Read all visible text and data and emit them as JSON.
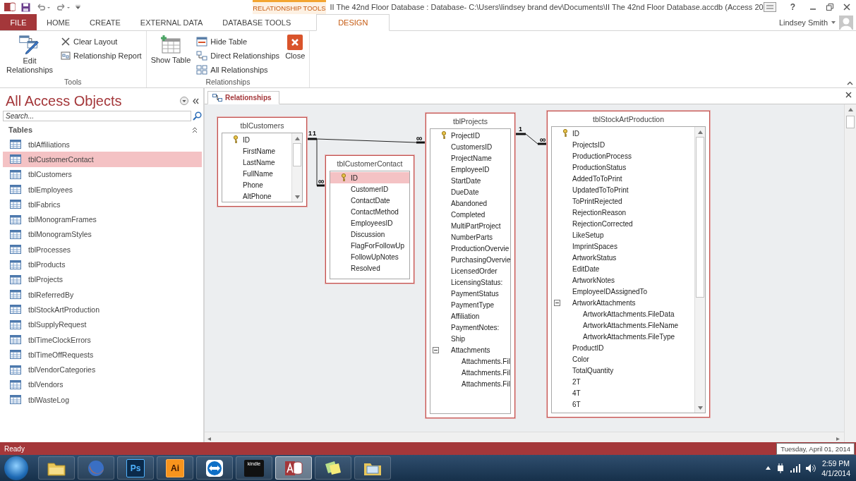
{
  "title_bar": {
    "context_tab": "RELATIONSHIP TOOLS",
    "title": "II The 42nd Floor Database : Database- C:\\Users\\lindsey brand dev\\Documents\\II The 42nd Floor Database.accdb (Access 20",
    "help": "?"
  },
  "ribbon_tabs": [
    {
      "label": "FILE",
      "kind": "file",
      "selected": false
    },
    {
      "label": "HOME",
      "kind": "tab",
      "selected": false
    },
    {
      "label": "CREATE",
      "kind": "tab",
      "selected": false
    },
    {
      "label": "EXTERNAL DATA",
      "kind": "tab",
      "selected": false
    },
    {
      "label": "DATABASE TOOLS",
      "kind": "tab",
      "selected": false
    },
    {
      "label": "DESIGN",
      "kind": "context",
      "selected": true
    }
  ],
  "user": {
    "name": "Lindsey Smith"
  },
  "ribbon_groups": [
    {
      "label": "Tools",
      "commands": [
        {
          "label": "Edit Relationships",
          "kind": "edit"
        },
        {
          "label": "Clear Layout",
          "kind": "clear"
        },
        {
          "label": "Relationship Report",
          "kind": "report"
        }
      ]
    },
    {
      "label": "Relationships",
      "commands": [
        {
          "label": "Show Table",
          "kind": "show"
        },
        {
          "label": "Hide Table",
          "kind": "hide"
        },
        {
          "label": "Direct Relationships",
          "kind": "direct"
        },
        {
          "label": "All Relationships",
          "kind": "all"
        },
        {
          "label": "Close",
          "kind": "close"
        }
      ]
    }
  ],
  "navigation_pane": {
    "title": "All Access Objects",
    "search": {
      "placeholder": "Search..."
    },
    "section": {
      "label": "Tables",
      "expanded": true
    },
    "items": [
      {
        "label": "tblAffiliations",
        "selected": false
      },
      {
        "label": "tblCustomerContact",
        "selected": true
      },
      {
        "label": "tblCustomers",
        "selected": false
      },
      {
        "label": "tblEmployees",
        "selected": false
      },
      {
        "label": "tblFabrics",
        "selected": false
      },
      {
        "label": "tblMonogramFrames",
        "selected": false
      },
      {
        "label": "tblMonogramStyles",
        "selected": false
      },
      {
        "label": "tblProcesses",
        "selected": false
      },
      {
        "label": "tblProducts",
        "selected": false
      },
      {
        "label": "tblProjects",
        "selected": false
      },
      {
        "label": "tblReferredBy",
        "selected": false
      },
      {
        "label": "tblStockArtProduction",
        "selected": false
      },
      {
        "label": "tblSupplyRequest",
        "selected": false
      },
      {
        "label": "tblTimeClockErrors",
        "selected": false
      },
      {
        "label": "tblTimeOffRequests",
        "selected": false
      },
      {
        "label": "tblVendorCategories",
        "selected": false
      },
      {
        "label": "tblVendors",
        "selected": false
      },
      {
        "label": "tblWasteLog",
        "selected": false
      }
    ]
  },
  "document_tabs": [
    {
      "label": "Relationships",
      "selected": true
    }
  ],
  "relationship_tables": [
    {
      "name": "tblCustomers",
      "scrollbar": true,
      "fields": [
        {
          "name": "ID",
          "key": true,
          "selected": false
        },
        {
          "name": "FirstName",
          "key": false,
          "selected": false
        },
        {
          "name": "LastName",
          "key": false,
          "selected": false
        },
        {
          "name": "FullName",
          "key": false,
          "selected": false
        },
        {
          "name": "Phone",
          "key": false,
          "selected": false
        },
        {
          "name": "AltPhone",
          "key": false,
          "selected": false
        }
      ]
    },
    {
      "name": "tblCustomerContact",
      "scrollbar": false,
      "fields": [
        {
          "name": "ID",
          "key": true,
          "selected": true
        },
        {
          "name": "CustomerID",
          "key": false,
          "selected": false
        },
        {
          "name": "ContactDate",
          "key": false,
          "selected": false
        },
        {
          "name": "ContactMethod",
          "key": false,
          "selected": false
        },
        {
          "name": "EmployeesID",
          "key": false,
          "selected": false
        },
        {
          "name": "Discussion",
          "key": false,
          "selected": false
        },
        {
          "name": "FlagForFollowUp",
          "key": false,
          "selected": false
        },
        {
          "name": "FollowUpNotes",
          "key": false,
          "selected": false
        },
        {
          "name": "Resolved",
          "key": false,
          "selected": false
        }
      ]
    },
    {
      "name": "tblProjects",
      "scrollbar": false,
      "fields": [
        {
          "name": "ProjectID",
          "key": true,
          "selected": false
        },
        {
          "name": "CustomersID",
          "key": false,
          "selected": false
        },
        {
          "name": "ProjectName",
          "key": false,
          "selected": false
        },
        {
          "name": "EmployeeID",
          "key": false,
          "selected": false
        },
        {
          "name": "StartDate",
          "key": false,
          "selected": false
        },
        {
          "name": "DueDate",
          "key": false,
          "selected": false
        },
        {
          "name": "Abandoned",
          "key": false,
          "selected": false
        },
        {
          "name": "Completed",
          "key": false,
          "selected": false
        },
        {
          "name": "MultiPartProject",
          "key": false,
          "selected": false
        },
        {
          "name": "NumberParts",
          "key": false,
          "selected": false
        },
        {
          "name": "ProductionOvervie",
          "key": false,
          "selected": false
        },
        {
          "name": "PurchasingOvervie",
          "key": false,
          "selected": false
        },
        {
          "name": "LicensedOrder",
          "key": false,
          "selected": false
        },
        {
          "name": "LicensingStatus:",
          "key": false,
          "selected": false
        },
        {
          "name": "PaymentStatus",
          "key": false,
          "selected": false
        },
        {
          "name": "PaymentType",
          "key": false,
          "selected": false
        },
        {
          "name": "Affiliation",
          "key": false,
          "selected": false
        },
        {
          "name": "PaymentNotes:",
          "key": false,
          "selected": false
        },
        {
          "name": "Ship",
          "key": false,
          "selected": false
        },
        {
          "name": "Attachments",
          "key": false,
          "selected": false,
          "expanded": true,
          "children": [
            {
              "name": "Attachments.Fil",
              "key": false,
              "selected": false
            },
            {
              "name": "Attachments.Fil",
              "key": false,
              "selected": false
            },
            {
              "name": "Attachments.Fil",
              "key": false,
              "selected": false
            }
          ]
        }
      ]
    },
    {
      "name": "tblStockArtProduction",
      "scrollbar": true,
      "fields": [
        {
          "name": "ID",
          "key": true,
          "selected": false
        },
        {
          "name": "ProjectsID",
          "key": false,
          "selected": false
        },
        {
          "name": "ProductionProcess",
          "key": false,
          "selected": false
        },
        {
          "name": "ProductionStatus",
          "key": false,
          "selected": false
        },
        {
          "name": "AddedToToPrint",
          "key": false,
          "selected": false
        },
        {
          "name": "UpdatedToToPrint",
          "key": false,
          "selected": false
        },
        {
          "name": "ToPrintRejected",
          "key": false,
          "selected": false
        },
        {
          "name": "RejectionReason",
          "key": false,
          "selected": false
        },
        {
          "name": "RejectionCorrected",
          "key": false,
          "selected": false
        },
        {
          "name": "LikeSetup",
          "key": false,
          "selected": false
        },
        {
          "name": "ImprintSpaces",
          "key": false,
          "selected": false
        },
        {
          "name": "ArtworkStatus",
          "key": false,
          "selected": false
        },
        {
          "name": "EditDate",
          "key": false,
          "selected": false
        },
        {
          "name": "ArtworkNotes",
          "key": false,
          "selected": false
        },
        {
          "name": "EmployeeIDAssignedTo",
          "key": false,
          "selected": false
        },
        {
          "name": "ArtworkAttachments",
          "key": false,
          "selected": false,
          "expanded": true,
          "children": [
            {
              "name": "ArtworkAttachments.FileData",
              "key": false,
              "selected": false
            },
            {
              "name": "ArtworkAttachments.FileName",
              "key": false,
              "selected": false
            },
            {
              "name": "ArtworkAttachments.FileType",
              "key": false,
              "selected": false
            }
          ]
        },
        {
          "name": "ProductID",
          "key": false,
          "selected": false
        },
        {
          "name": "Color",
          "key": false,
          "selected": false
        },
        {
          "name": "TotalQuantity",
          "key": false,
          "selected": false
        },
        {
          "name": "2T",
          "key": false,
          "selected": false
        },
        {
          "name": "4T",
          "key": false,
          "selected": false
        },
        {
          "name": "6T",
          "key": false,
          "selected": false
        }
      ]
    }
  ],
  "relationships": [
    {
      "from_label": "1",
      "to_label": "∞"
    },
    {
      "from_label": "1",
      "to_label": "∞"
    },
    {
      "from_label": "1",
      "to_label": "∞"
    }
  ],
  "status_bar": {
    "text": "Ready",
    "tooltip": "Tuesday, April 01, 2014"
  },
  "taskbar": {
    "items": [
      {
        "kind": "explorer",
        "active": false
      },
      {
        "kind": "firefox",
        "active": false
      },
      {
        "kind": "photoshop",
        "label": "Ps",
        "active": false
      },
      {
        "kind": "illustrator",
        "label": "Ai",
        "active": false
      },
      {
        "kind": "teamviewer",
        "active": false
      },
      {
        "kind": "kindle",
        "label": "kindle",
        "active": false
      },
      {
        "kind": "access",
        "active": true
      },
      {
        "kind": "notes",
        "active": false
      },
      {
        "kind": "folder",
        "active": false
      }
    ],
    "clock": {
      "time": "2:59 PM",
      "date": "4/1/2014"
    }
  }
}
